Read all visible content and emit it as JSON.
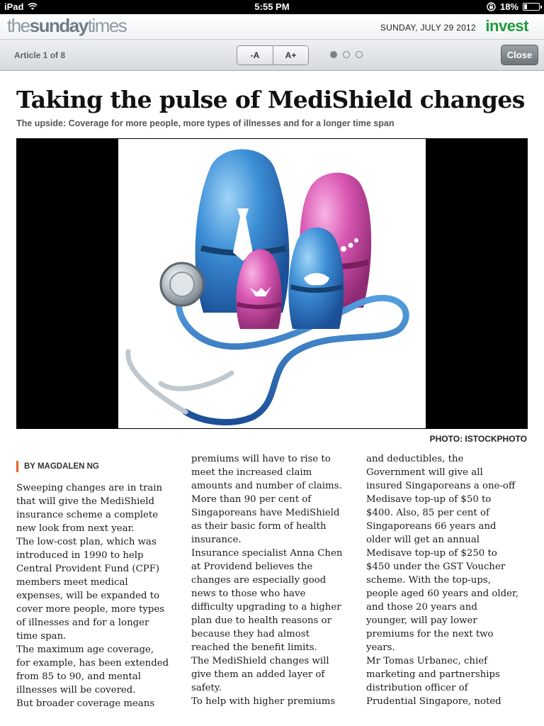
{
  "status_bar": {
    "device": "iPad",
    "time": "5:55 PM",
    "battery": "18%",
    "battery_level": 0.18
  },
  "masthead": {
    "logo_prefix": "the",
    "logo_bold": "sunday",
    "logo_suffix": "times",
    "date": "SUNDAY, JULY 29 2012",
    "section": "invest"
  },
  "toolbar": {
    "counter": "Article 1 of 8",
    "font_smaller": "-A",
    "font_larger": "A+",
    "close": "Close",
    "pages": 3,
    "active_page": 0
  },
  "article": {
    "headline": "Taking the pulse of MediShield changes",
    "subhead": "The upside: Coverage for more people, more types of illnesses and for a longer time span",
    "photo_credit": "PHOTO: ISTOCKPHOTO",
    "byline": "BY MAGDALEN NG",
    "columns": [
      "Sweeping changes are in train\nthat will give the MediShield\ninsurance scheme a complete\nnew look from next year.\n The low-cost plan, which was\nintroduced in 1990 to help\nCentral Provident Fund (CPF)\nmembers meet medical\nexpenses, will be expanded to\ncover more people, more types\nof illnesses and for a longer\ntime span.\n The maximum age coverage,\nfor example, has been extended\nfrom 85 to 90, and mental\nillnesses will be covered.\n But broader coverage means",
      "premiums will have to rise to\nmeet the increased claim\namounts and number of claims.\n More than 90 per cent of\nSingaporeans have MediShield\nas their basic form of health\ninsurance.\n Insurance specialist Anna Chen\nat Providend believes the\nchanges are especially good\nnews to those who have\ndifficulty upgrading to a higher\nplan due to health reasons or\nbecause they had almost\nreached the benefit limits.\n The MediShield changes will\ngive them an added layer of\nsafety.\n To help with higher premiums",
      "and deductibles, the\nGovernment will give all\ninsured Singaporeans a one-off\nMedisave top-up of $50 to\n$400. Also, 85 per cent of\nSingaporeans 66 years and\nolder will get an annual\nMedisave top-up of $250 to\n$450 under the GST Voucher\nscheme. With the top-ups,\npeople aged 60 years and older,\nand those 20 years and\nyounger, will pay lower\npremiums for the next two\nyears.\n Mr Tomas Urbanec, chief\nmarketing and partnerships\ndistribution officer of\nPrudential Singapore, noted"
    ]
  }
}
